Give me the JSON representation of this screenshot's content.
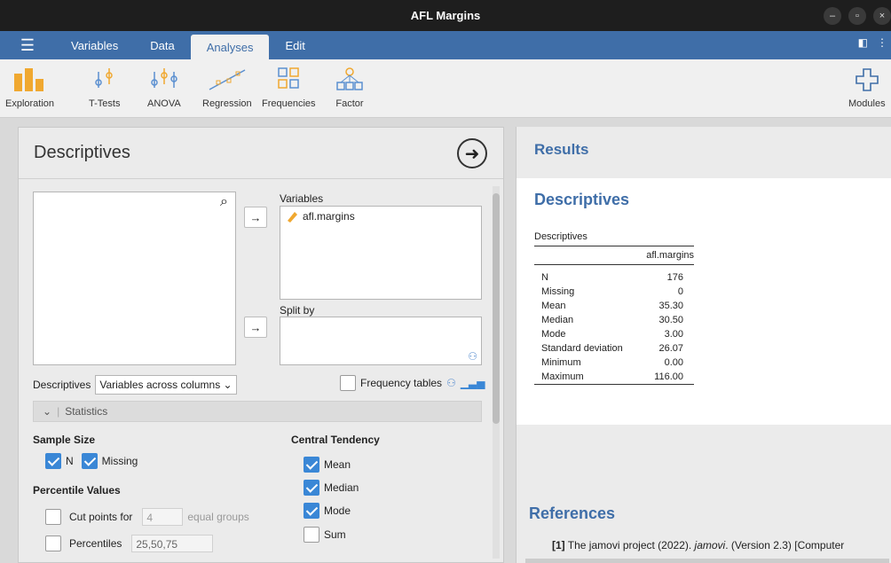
{
  "window": {
    "title": "AFL Margins"
  },
  "menu": {
    "tabs": [
      "Variables",
      "Data",
      "Analyses",
      "Edit"
    ]
  },
  "ribbon": {
    "items": [
      "Exploration",
      "T-Tests",
      "ANOVA",
      "Regression",
      "Frequencies",
      "Factor"
    ],
    "modules": "Modules"
  },
  "options": {
    "title": "Descriptives",
    "variables_label": "Variables",
    "variables": [
      "afl.margins"
    ],
    "splitby_label": "Split by",
    "descriptives_label": "Descriptives",
    "descriptives_mode": "Variables across columns",
    "freq_tables": "Frequency tables",
    "statistics_section": "Statistics",
    "sample_size": "Sample Size",
    "n_label": "N",
    "missing_label": "Missing",
    "percentile_values": "Percentile Values",
    "cut_points_label": "Cut points for",
    "cut_points_value": "4",
    "equal_groups": "equal groups",
    "percentiles_label": "Percentiles",
    "percentiles_value": "25,50,75",
    "central_tendency": "Central Tendency",
    "mean_label": "Mean",
    "median_label": "Median",
    "mode_label": "Mode",
    "sum_label": "Sum"
  },
  "results": {
    "title": "Results",
    "descriptives_heading": "Descriptives",
    "table_caption": "Descriptives",
    "column": "afl.margins",
    "rows": [
      {
        "label": "N",
        "value": "176"
      },
      {
        "label": "Missing",
        "value": "0"
      },
      {
        "label": "Mean",
        "value": "35.30"
      },
      {
        "label": "Median",
        "value": "30.50"
      },
      {
        "label": "Mode",
        "value": "3.00"
      },
      {
        "label": "Standard deviation",
        "value": "26.07"
      },
      {
        "label": "Minimum",
        "value": "0.00"
      },
      {
        "label": "Maximum",
        "value": "116.00"
      }
    ],
    "references_heading": "References",
    "ref_num": "[1]",
    "ref_text_a": "The jamovi project (2022). ",
    "ref_text_b": "jamovi",
    "ref_text_c": ". (Version 2.3) [Computer"
  },
  "colors": {
    "accent": "#3f6ea8",
    "checkbox": "#3a87d6"
  }
}
